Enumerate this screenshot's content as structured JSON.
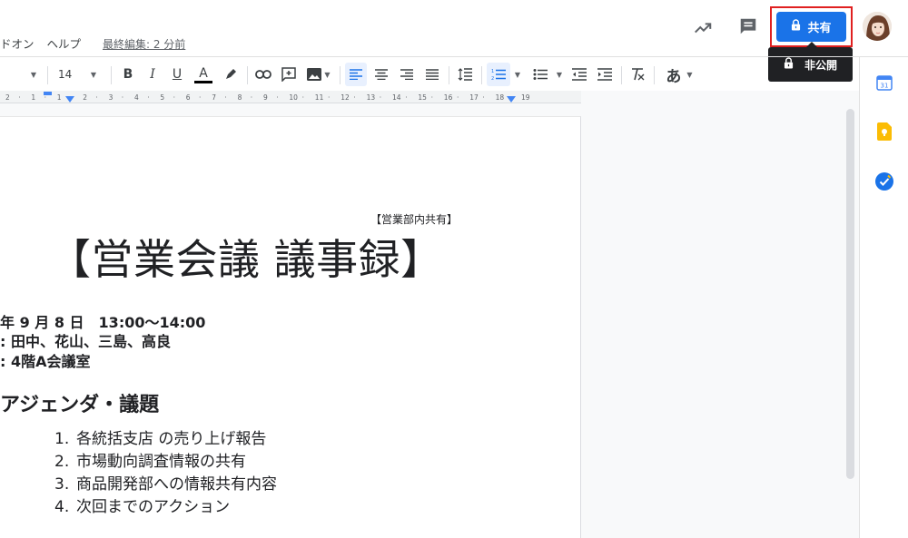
{
  "menubar": {
    "items": [
      "ドオン",
      "ヘルプ"
    ],
    "last_edit": "最終編集: 2 分前"
  },
  "header": {
    "icons": [
      "trending-up-icon",
      "comment-icon"
    ],
    "share_button": {
      "label": "共有",
      "icon": "lock-icon"
    },
    "tooltip": {
      "label": "非公開",
      "icon": "lock-icon"
    },
    "highlight_color": "#e02020",
    "accent_color": "#1a73e8"
  },
  "toolbar": {
    "font_size": "14",
    "color_letter": "A",
    "lang_glyph": "あ"
  },
  "ruler": {
    "ticks": [
      "2",
      "1",
      "1",
      "2",
      "3",
      "4",
      "5",
      "6",
      "7",
      "8",
      "9",
      "10",
      "11",
      "12",
      "13",
      "14",
      "15",
      "16",
      "17",
      "18",
      "19"
    ]
  },
  "document": {
    "note": "【営業部内共有】",
    "title": "【営業会議 議事録】",
    "info_lines": [
      "年 9 月 8 日　13:00〜14:00",
      ": 田中、花山、三島、高良",
      ": 4階A会議室"
    ],
    "agenda_heading": "アジェンダ・議題",
    "agenda_items": [
      {
        "num": "1.",
        "text": "各統括支店 の売り上げ報告"
      },
      {
        "num": "2.",
        "text": "市場動向調査情報の共有"
      },
      {
        "num": "3.",
        "text": "商品開発部への情報共有内容"
      },
      {
        "num": "4.",
        "text": "次回までのアクション"
      }
    ]
  },
  "sidebar": {
    "icons": [
      "calendar-icon",
      "keep-icon",
      "tasks-icon"
    ],
    "calendar_label": "31"
  }
}
